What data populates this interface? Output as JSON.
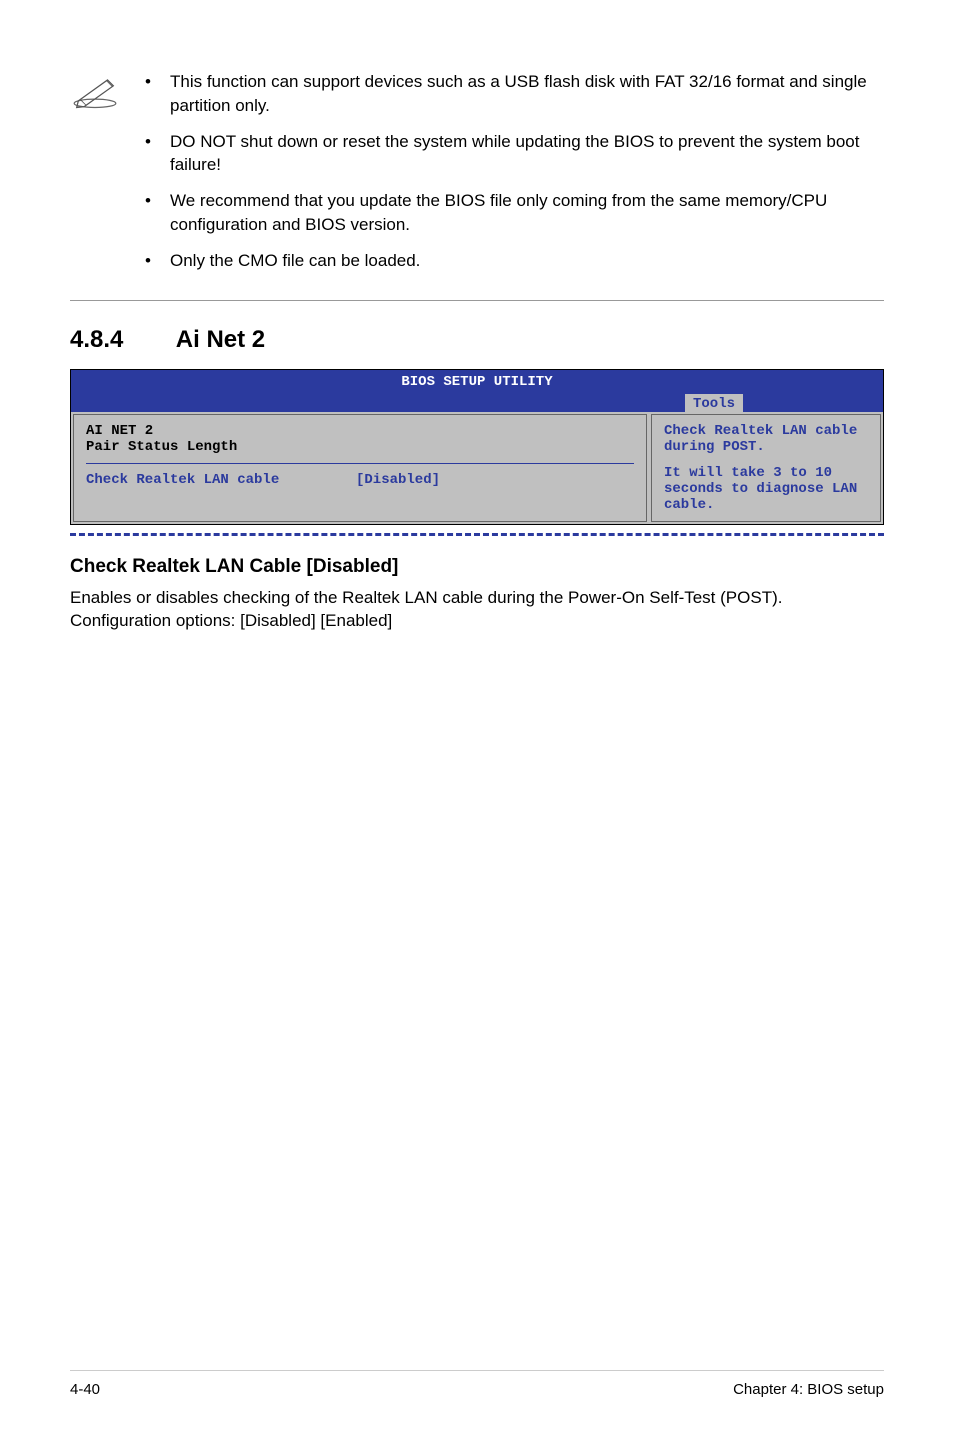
{
  "notes": {
    "items": [
      "This function can support devices such as a USB flash disk with FAT 32/16 format and single partition only.",
      "DO NOT shut down or reset the system while updating the BIOS to prevent the system boot failure!",
      "We recommend that you update the BIOS file only coming from the same memory/CPU configuration and BIOS version.",
      "Only the CMO file can be loaded."
    ]
  },
  "section": {
    "number": "4.8.4",
    "title": "Ai Net 2"
  },
  "bios": {
    "title": "BIOS SETUP UTILITY",
    "tab": "Tools",
    "left_header1": "AI NET 2",
    "left_header2": "Pair  Status  Length",
    "setting_label": "Check Realtek LAN cable",
    "setting_value": "[Disabled]",
    "right_line1": "Check Realtek LAN cable during POST.",
    "right_line2": "It will take 3 to 10 seconds to diagnose LAN cable."
  },
  "subsection": {
    "title": "Check Realtek LAN Cable [Disabled]",
    "body": "Enables or disables checking of the Realtek LAN cable during the Power-On Self-Test (POST). Configuration options: [Disabled] [Enabled]"
  },
  "footer": {
    "left": "4-40",
    "right": "Chapter 4: BIOS setup"
  }
}
